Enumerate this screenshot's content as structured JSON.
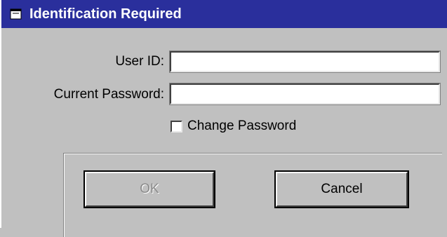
{
  "window": {
    "title": "Identification Required",
    "title_bar_color": "#2a2f9c",
    "background_color": "#c0c0c0"
  },
  "form": {
    "user_id_label": "User ID:",
    "user_id_value": "",
    "current_password_label": "Current Password:",
    "current_password_value": "",
    "change_password_label": "Change Password",
    "change_password_checked": false
  },
  "buttons": {
    "ok_label": "OK",
    "ok_enabled": false,
    "cancel_label": "Cancel"
  },
  "icons": {
    "title_icon": "app-window-icon"
  }
}
